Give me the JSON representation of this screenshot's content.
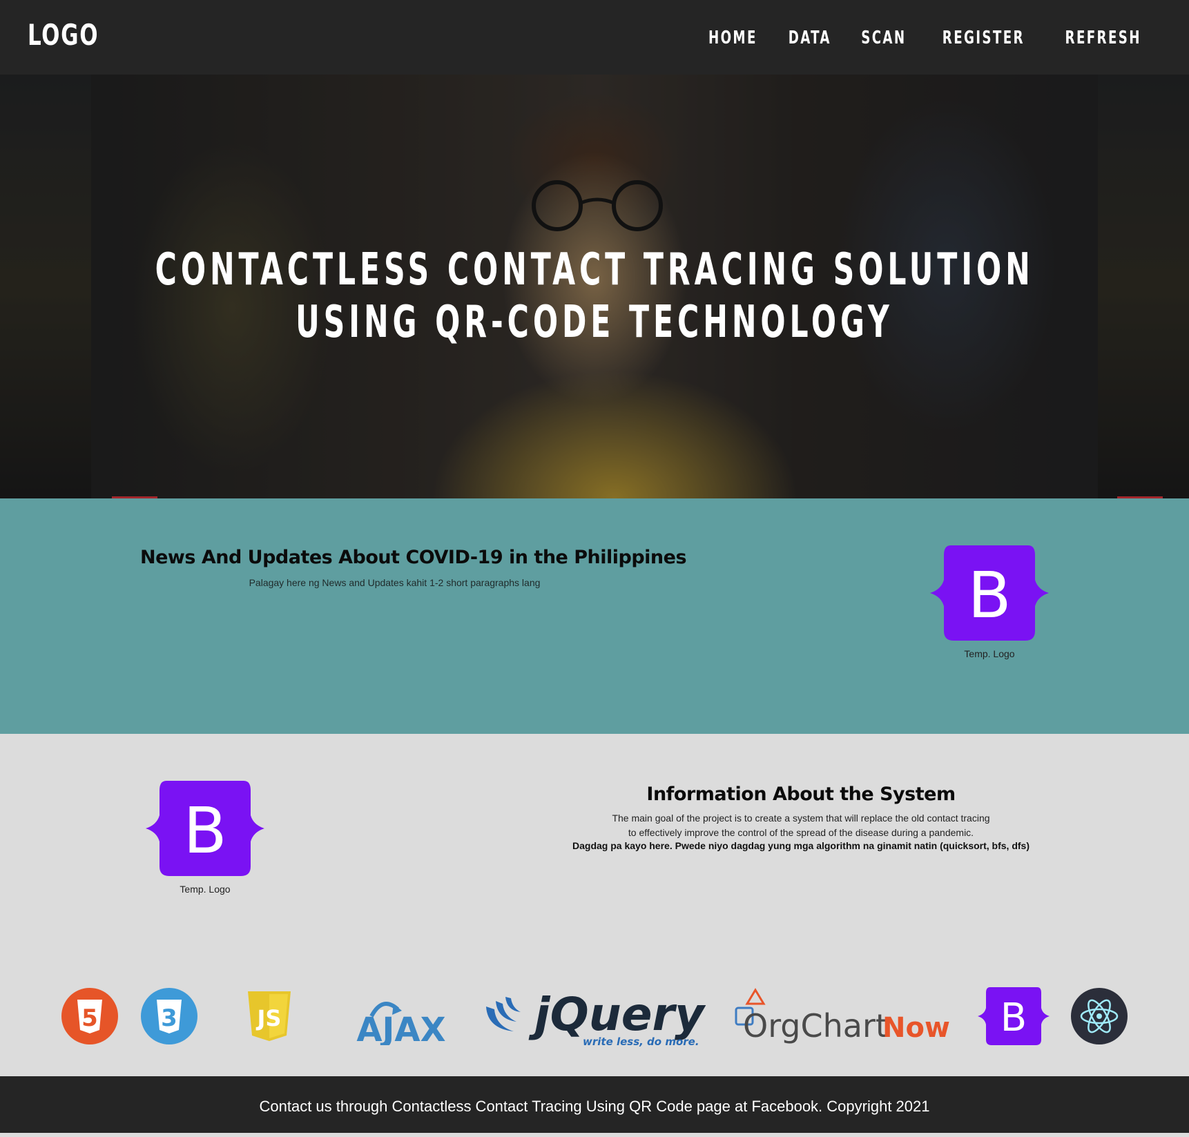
{
  "navbar": {
    "logo": "LOGO",
    "items": [
      "HOME",
      "DATA",
      "SCAN",
      "REGISTER",
      "REFRESH"
    ]
  },
  "hero": {
    "title_line1": "CONTACTLESS CONTACT TRACING SOLUTION",
    "title_line2": "USING QR-CODE TECHNOLOGY"
  },
  "news": {
    "title": "News And Updates About COVID-19 in the Philippines",
    "text": "Palagay here ng News and Updates kahit 1-2 short paragraphs lang",
    "logo_caption": "Temp. Logo"
  },
  "info": {
    "title": "Information About the System",
    "paragraph_line1": "The main goal of the project is to create a system that will replace the old contact tracing",
    "paragraph_line2": "to effectively improve the control of the spread of the disease during a pandemic.",
    "note": "Dagdag pa kayo here. Pwede niyo dagdag yung mga algorithm na ginamit natin (quicksort, bfs, dfs)",
    "logo_caption": "Temp. Logo"
  },
  "technologies": {
    "html5": "5",
    "css3": "3",
    "js": "JS",
    "ajax": "AJAX",
    "jquery": "jQuery",
    "jquery_tagline": "write less, do more.",
    "orgchart_org": "OrgChart",
    "orgchart_now": "Now",
    "bootstrap": "B"
  },
  "footer": {
    "text": "Contact us through Contactless Contact Tracing Using QR Code page at Facebook. Copyright 2021"
  },
  "colors": {
    "nav_bg": "#252525",
    "news_bg": "#5f9ea0",
    "info_bg": "#dcdcdc",
    "bootstrap_purple": "#7a12f3",
    "html5_orange": "#e65528",
    "css3_blue": "#3e9ad8",
    "js_yellow": "#e7c62b",
    "ajax_blue": "#3b86c4",
    "jquery_dark": "#1c2a3a",
    "orgchart_now_orange": "#e8552a",
    "electron_dark": "#2b2e3a"
  }
}
